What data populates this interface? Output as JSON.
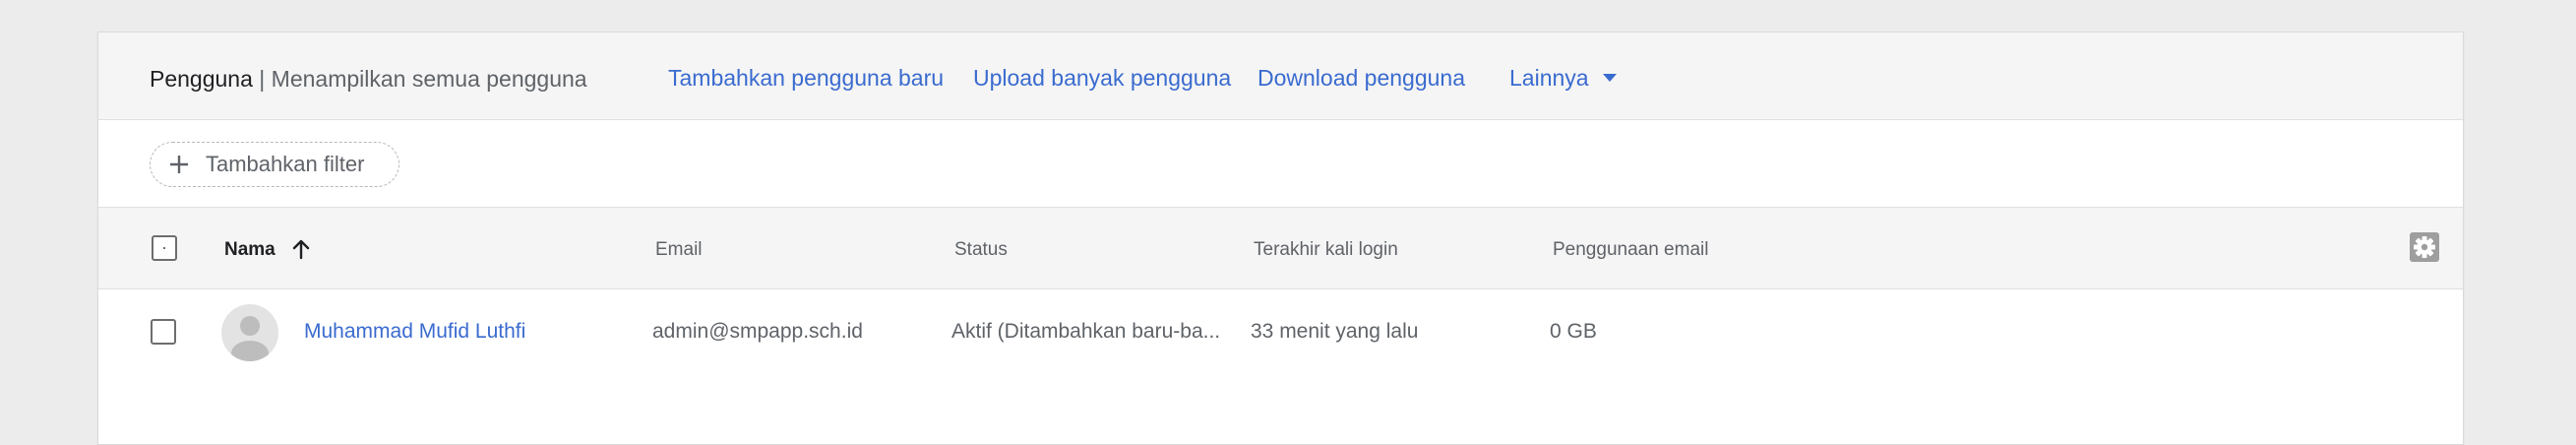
{
  "header": {
    "title": "Pengguna",
    "separator": "|",
    "subtitle": "Menampilkan semua pengguna",
    "actions": [
      {
        "label": "Tambahkan pengguna baru"
      },
      {
        "label": "Upload banyak pengguna"
      },
      {
        "label": "Download pengguna"
      },
      {
        "label": "Lainnya"
      }
    ]
  },
  "filter": {
    "label": "Tambahkan filter",
    "icon": "plus-icon"
  },
  "table": {
    "columns": [
      "Nama",
      "Email",
      "Status",
      "Terakhir kali login",
      "Penggunaan email"
    ],
    "sort_icon": "arrow-up-icon",
    "settings_icon": "gear-icon",
    "rows": [
      {
        "avatar_icon": "person-icon",
        "name": "Muhammad Mufid Luthfi",
        "email": "admin@smpapp.sch.id",
        "status": "Aktif (Ditambahkan baru-ba...",
        "last_login": "33 menit yang lalu",
        "email_usage": "0 GB"
      }
    ]
  },
  "colors": {
    "link": "#3a6bcf",
    "header_bg": "#f5f5f5",
    "page_bg": "#ececec",
    "text_primary": "#202124",
    "text_secondary": "#5f6368"
  }
}
